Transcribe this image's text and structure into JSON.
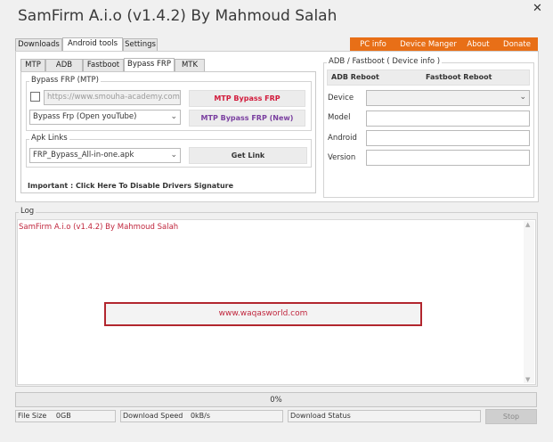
{
  "window": {
    "title": "SamFirm A.i.o (v1.4.2) By Mahmoud Salah",
    "close_glyph": "✕"
  },
  "main_tabs": [
    "Downloads",
    "Android tools",
    "Settings"
  ],
  "top_nav": [
    "PC info",
    "Device Manger",
    "About",
    "Donate"
  ],
  "sub_tabs": [
    "MTP",
    "ADB",
    "Fastboot",
    "Bypass FRP",
    "MTK"
  ],
  "bypass_frp": {
    "group_title": "Bypass FRP (MTP)",
    "url_placeholder": "https://www.smouha-academy.com",
    "mtp_button": "MTP Bypass FRP",
    "method_selected": "Bypass Frp (Open youTube)",
    "mtp_new_button": "MTP Bypass FRP (New)"
  },
  "apk_links": {
    "group_title": "Apk Links",
    "selected": "FRP_Bypass_All-in-one.apk",
    "get_link_button": "Get Link"
  },
  "important_text": "Important : Click Here To Disable Drivers Signature",
  "adb_fastboot": {
    "group_title": "ADB / Fastboot ( Device info )",
    "adb_reboot": "ADB Reboot",
    "fastboot_reboot": "Fastboot Reboot",
    "fields": [
      {
        "label": "Device",
        "value": ""
      },
      {
        "label": "Model",
        "value": ""
      },
      {
        "label": "Android",
        "value": ""
      },
      {
        "label": "Version",
        "value": ""
      }
    ]
  },
  "log": {
    "label": "Log",
    "first_line": "SamFirm A.i.o (v1.4.2) By Mahmoud Salah",
    "watermark": "www.waqasworld.com"
  },
  "progress": {
    "text": "0%",
    "value": 0
  },
  "status": {
    "file_size_label": "File Size",
    "file_size_value": "0GB",
    "speed_label": "Download Speed",
    "speed_value": "0kB/s",
    "status_label": "Download Status",
    "status_value": "",
    "stop_button": "Stop"
  },
  "colors": {
    "accent_orange": "#e86f17",
    "red_text": "#d21b3c",
    "purple_text": "#7a3fa0",
    "green_text": "#2f9a2f"
  }
}
